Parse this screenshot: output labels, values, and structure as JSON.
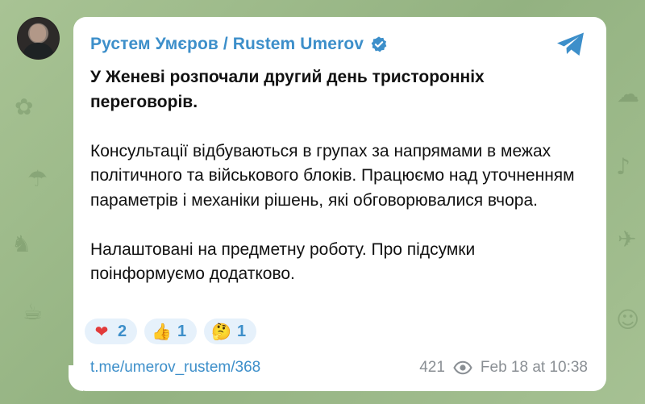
{
  "channel": {
    "author_name": "Рустем Умєров / Rustem Umerov"
  },
  "post": {
    "paragraphs": [
      "У Женеві розпочали другий день тристоронніх переговорів.",
      "Консультації відбуваються в групах за напрямами в межах політичного та військового блоків. Працюємо над уточненням параметрів і механіки рішень, які обговорювалися вчора.",
      "Налаштовані на предметну роботу. Про підсумки поінформуємо додатково."
    ],
    "reactions": [
      {
        "emoji": "❤",
        "icon": "heart-icon",
        "count": "2"
      },
      {
        "emoji": "👍",
        "icon": "thumbs-up-icon",
        "count": "1"
      },
      {
        "emoji": "🤔",
        "icon": "thinking-face-icon",
        "count": "1"
      }
    ],
    "link": "t.me/umerov_rustem/368",
    "views": "421",
    "timestamp": "Feb 18 at 10:38"
  },
  "icons": {
    "verified": "verified-badge-icon",
    "share": "telegram-send-icon",
    "views": "eye-icon"
  },
  "colors": {
    "accent": "#3d8fca",
    "reaction_bg": "#e6f1fb",
    "meta_text": "#8a8f94",
    "wallpaper": "#9bb78a"
  }
}
